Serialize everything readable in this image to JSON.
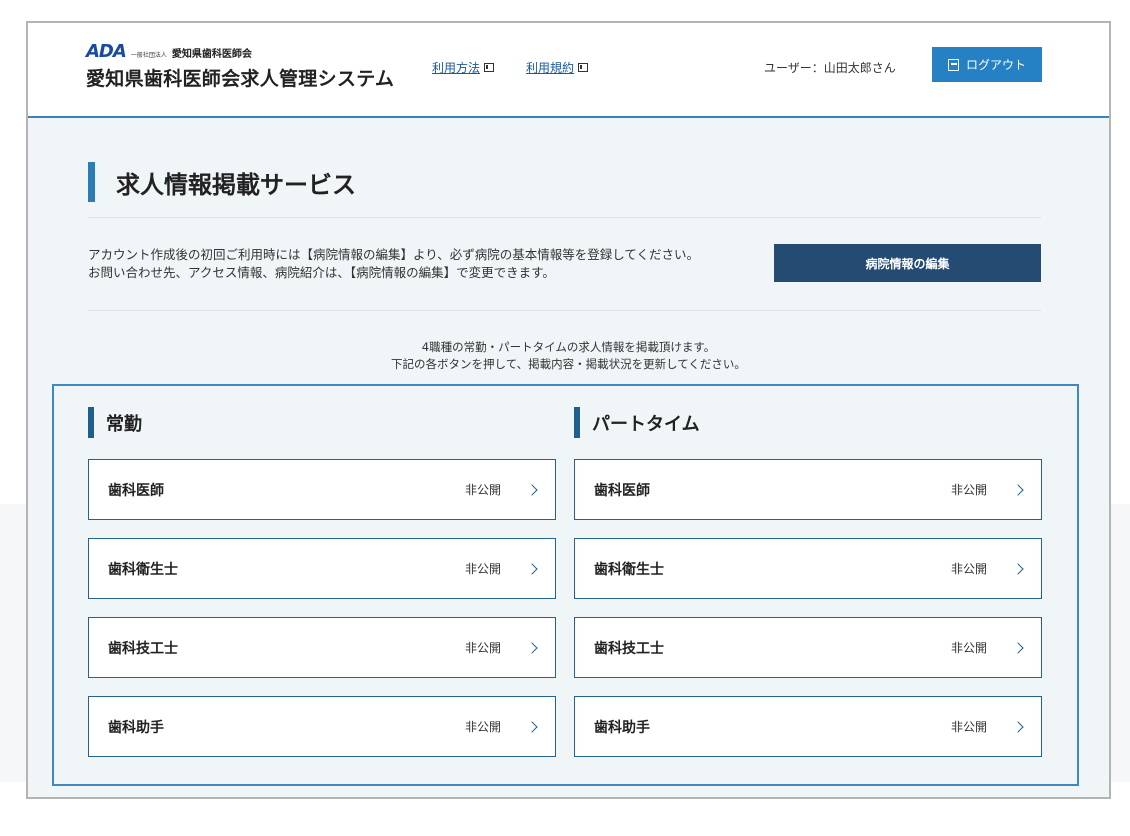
{
  "header": {
    "logo_ada": "ADA",
    "logo_corp": "一般社団法人",
    "logo_association": "愛知県歯科医師会",
    "app_title": "愛知県歯科医師会求人管理システム",
    "links": [
      {
        "label": "利用方法",
        "icon": "external-window-icon"
      },
      {
        "label": "利用規約",
        "icon": "external-window-icon"
      }
    ],
    "user_text": "ユーザー：山田太郎さん",
    "logout_label": "ログアウト",
    "logout_icon": "logout-icon",
    "accent_color": "#2581c4"
  },
  "main": {
    "page_title": "求人情報掲載サービス",
    "notice_lines": [
      "アカウント作成後の初回ご利用時には【病院情報の編集】より、必ず病院の基本情報等を登録してください。",
      "お問い合わせ先、アクセス情報、病院紹介は、【病院情報の編集】で変更できます。"
    ],
    "edit_button_label": "病院情報の編集",
    "edit_button_color": "#254b73",
    "intro_lines": [
      "4職種の常勤・パートタイムの求人情報を掲載頂けます。",
      "下記の各ボタンを押して、掲載内容・掲載状況を更新してください。"
    ]
  },
  "columns": [
    {
      "heading": "常勤",
      "jobs": [
        {
          "name": "歯科医師",
          "status": "非公開"
        },
        {
          "name": "歯科衛生士",
          "status": "非公開"
        },
        {
          "name": "歯科技工士",
          "status": "非公開"
        },
        {
          "name": "歯科助手",
          "status": "非公開"
        }
      ]
    },
    {
      "heading": "パートタイム",
      "jobs": [
        {
          "name": "歯科医師",
          "status": "非公開"
        },
        {
          "name": "歯科衛生士",
          "status": "非公開"
        },
        {
          "name": "歯科技工士",
          "status": "非公開"
        },
        {
          "name": "歯科助手",
          "status": "非公開"
        }
      ]
    }
  ]
}
